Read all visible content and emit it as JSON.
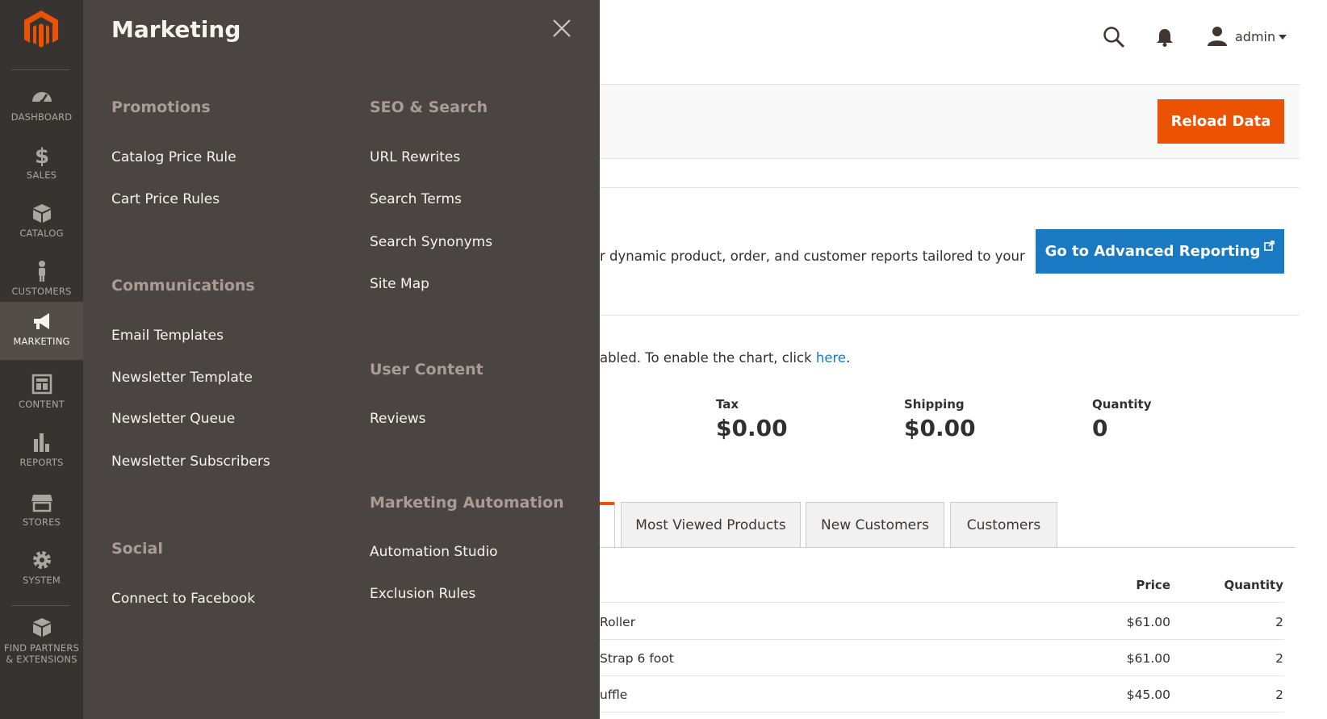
{
  "nav": {
    "items": [
      {
        "label": "DASHBOARD",
        "icon": "dashboard-icon"
      },
      {
        "label": "SALES",
        "icon": "dollar-icon"
      },
      {
        "label": "CATALOG",
        "icon": "cube-icon"
      },
      {
        "label": "CUSTOMERS",
        "icon": "person-icon"
      },
      {
        "label": "MARKETING",
        "icon": "megaphone-icon"
      },
      {
        "label": "CONTENT",
        "icon": "layout-icon"
      },
      {
        "label": "REPORTS",
        "icon": "bar-chart-icon"
      },
      {
        "label": "STORES",
        "icon": "storefront-icon"
      },
      {
        "label": "SYSTEM",
        "icon": "gear-icon"
      },
      {
        "label_line1": "FIND PARTNERS",
        "label_line2": "& EXTENSIONS",
        "icon": "blocks-icon"
      }
    ],
    "active": "MARKETING",
    "colors": {
      "bg": "#373330",
      "active_bg": "#524d49",
      "logo": "#eb5202"
    }
  },
  "flyout": {
    "title": "Marketing",
    "groups": {
      "promotions": {
        "title": "Promotions",
        "items": [
          "Catalog Price Rule",
          "Cart Price Rules"
        ]
      },
      "communications": {
        "title": "Communications",
        "items": [
          "Email Templates",
          "Newsletter Template",
          "Newsletter Queue",
          "Newsletter Subscribers"
        ]
      },
      "social": {
        "title": "Social",
        "items": [
          "Connect to Facebook"
        ]
      },
      "seo": {
        "title": "SEO & Search",
        "items": [
          "URL Rewrites",
          "Search Terms",
          "Search Synonyms",
          "Site Map"
        ]
      },
      "user_content": {
        "title": "User Content",
        "items": [
          "Reviews"
        ]
      },
      "automation": {
        "title": "Marketing Automation",
        "items": [
          "Automation Studio",
          "Exclusion Rules"
        ]
      }
    }
  },
  "header": {
    "username": "admin"
  },
  "actions": {
    "reload": "Reload Data",
    "advanced": "Go to Advanced Reporting"
  },
  "advanced_text": "r dynamic product, order, and customer reports tailored to your",
  "chart_notice": {
    "text": "abled. To enable the chart, click ",
    "link": "here",
    "suffix": "."
  },
  "totals": [
    {
      "label": "Tax",
      "value": "$0.00"
    },
    {
      "label": "Shipping",
      "value": "$0.00"
    },
    {
      "label": "Quantity",
      "value": "0"
    }
  ],
  "tabs": [
    "Most Viewed Products",
    "New Customers",
    "Customers"
  ],
  "table": {
    "headers": {
      "price": "Price",
      "quantity": "Quantity"
    },
    "rows": [
      {
        "product": "Roller",
        "price": "$61.00",
        "quantity": "2"
      },
      {
        "product": "Strap 6 foot",
        "price": "$61.00",
        "quantity": "2"
      },
      {
        "product": "uffle",
        "price": "$45.00",
        "quantity": "2"
      }
    ]
  },
  "colors": {
    "orange": "#eb5202",
    "blue": "#1979c3"
  }
}
